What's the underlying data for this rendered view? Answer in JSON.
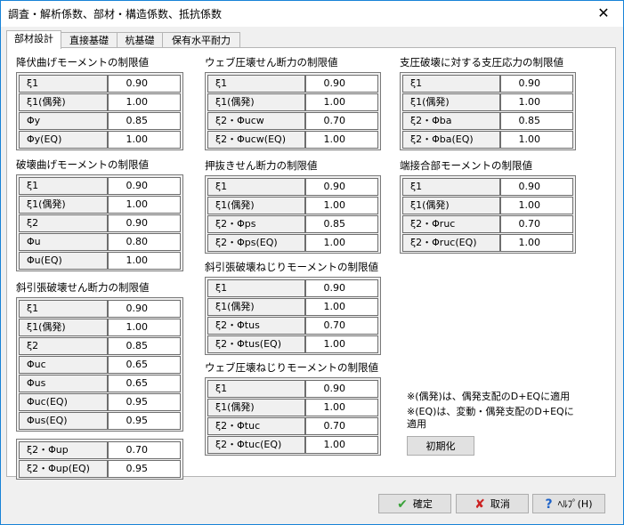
{
  "window": {
    "title": "調査・解析係数、部材・構造係数、抵抗係数",
    "close": "✕"
  },
  "tabs": [
    "部材設計",
    "直接基礎",
    "杭基礎",
    "保有水平耐力"
  ],
  "sections": [
    {
      "title": "降伏曲げモーメントの制限値",
      "rows": [
        [
          "ξ1",
          "0.90"
        ],
        [
          "ξ1(偶発)",
          "1.00"
        ],
        [
          "Φy",
          "0.85"
        ],
        [
          "Φy(EQ)",
          "1.00"
        ]
      ]
    },
    {
      "title": "破壊曲げモーメントの制限値",
      "rows": [
        [
          "ξ1",
          "0.90"
        ],
        [
          "ξ1(偶発)",
          "1.00"
        ],
        [
          "ξ2",
          "0.90"
        ],
        [
          "Φu",
          "0.80"
        ],
        [
          "Φu(EQ)",
          "1.00"
        ]
      ]
    },
    {
      "title": "斜引張破壊せん断力の制限値",
      "rows": [
        [
          "ξ1",
          "0.90"
        ],
        [
          "ξ1(偶発)",
          "1.00"
        ],
        [
          "ξ2",
          "0.85"
        ],
        [
          "Φuc",
          "0.65"
        ],
        [
          "Φus",
          "0.65"
        ],
        [
          "Φuc(EQ)",
          "0.95"
        ],
        [
          "Φus(EQ)",
          "0.95"
        ]
      ],
      "extra_rows": [
        [
          "ξ2・Φup",
          "0.70"
        ],
        [
          "ξ2・Φup(EQ)",
          "0.95"
        ]
      ]
    },
    {
      "title": "ウェブ圧壊せん断力の制限値",
      "rows": [
        [
          "ξ1",
          "0.90"
        ],
        [
          "ξ1(偶発)",
          "1.00"
        ],
        [
          "ξ2・Φucw",
          "0.70"
        ],
        [
          "ξ2・Φucw(EQ)",
          "1.00"
        ]
      ]
    },
    {
      "title": "押抜きせん断力の制限値",
      "rows": [
        [
          "ξ1",
          "0.90"
        ],
        [
          "ξ1(偶発)",
          "1.00"
        ],
        [
          "ξ2・Φps",
          "0.85"
        ],
        [
          "ξ2・Φps(EQ)",
          "1.00"
        ]
      ]
    },
    {
      "title": "斜引張破壊ねじりモーメントの制限値",
      "rows": [
        [
          "ξ1",
          "0.90"
        ],
        [
          "ξ1(偶発)",
          "1.00"
        ],
        [
          "ξ2・Φtus",
          "0.70"
        ],
        [
          "ξ2・Φtus(EQ)",
          "1.00"
        ]
      ]
    },
    {
      "title": "ウェブ圧壊ねじりモーメントの制限値",
      "rows": [
        [
          "ξ1",
          "0.90"
        ],
        [
          "ξ1(偶発)",
          "1.00"
        ],
        [
          "ξ2・Φtuc",
          "0.70"
        ],
        [
          "ξ2・Φtuc(EQ)",
          "1.00"
        ]
      ]
    },
    {
      "title": "支圧破壊に対する支圧応力の制限値",
      "rows": [
        [
          "ξ1",
          "0.90"
        ],
        [
          "ξ1(偶発)",
          "1.00"
        ],
        [
          "ξ2・Φba",
          "0.85"
        ],
        [
          "ξ2・Φba(EQ)",
          "1.00"
        ]
      ]
    },
    {
      "title": "端接合部モーメントの制限値",
      "rows": [
        [
          "ξ1",
          "0.90"
        ],
        [
          "ξ1(偶発)",
          "1.00"
        ],
        [
          "ξ2・Φruc",
          "0.70"
        ],
        [
          "ξ2・Φruc(EQ)",
          "1.00"
        ]
      ]
    }
  ],
  "notes": [
    "※(偶発)は、偶発支配のD+EQに適用",
    "※(EQ)は、変動・偶発支配のD+EQに",
    "適用"
  ],
  "buttons": {
    "init": "初期化",
    "ok": "確定",
    "cancel": "取消",
    "help": "ﾍﾙﾌﾟ(H)"
  },
  "icons": {
    "ok": "check-icon",
    "cancel": "x-icon",
    "help": "question-icon"
  }
}
